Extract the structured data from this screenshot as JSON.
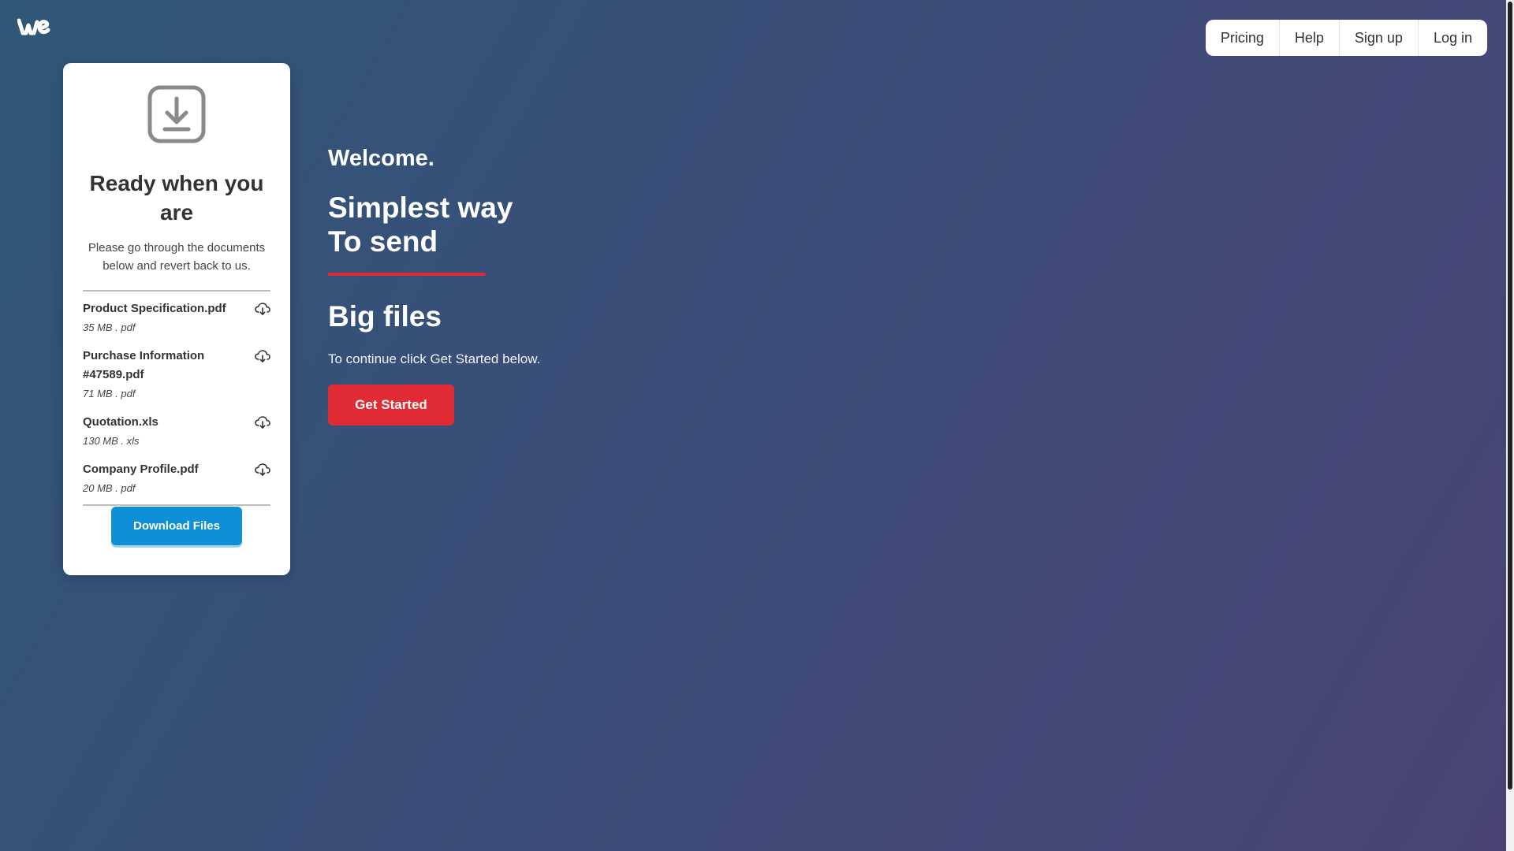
{
  "header": {
    "logo": "we-logo-icon",
    "nav": [
      {
        "label": "Pricing"
      },
      {
        "label": "Help"
      },
      {
        "label": "Sign up"
      },
      {
        "label": "Log in"
      }
    ]
  },
  "card": {
    "icon": "download-box-icon",
    "title": "Ready when you are",
    "description": "Please go through the documents below and revert back to us.",
    "files": [
      {
        "name": "Product Specification.pdf",
        "meta": "35 MB . pdf"
      },
      {
        "name": "Purchase Information #47589.pdf",
        "meta": "71 MB . pdf"
      },
      {
        "name": "Quotation.xls",
        "meta": "130 MB . xls"
      },
      {
        "name": "Company Profile.pdf",
        "meta": "20 MB . pdf"
      }
    ],
    "download_label": "Download Files"
  },
  "hero": {
    "welcome": "Welcome.",
    "headline_line1": "Simplest way",
    "headline_line2": "To send",
    "subheadline": "Big files",
    "instruction": "To continue click Get Started below.",
    "cta_label": "Get Started"
  },
  "colors": {
    "accent_red": "#e02b35",
    "accent_blue": "#0e8fd6"
  }
}
